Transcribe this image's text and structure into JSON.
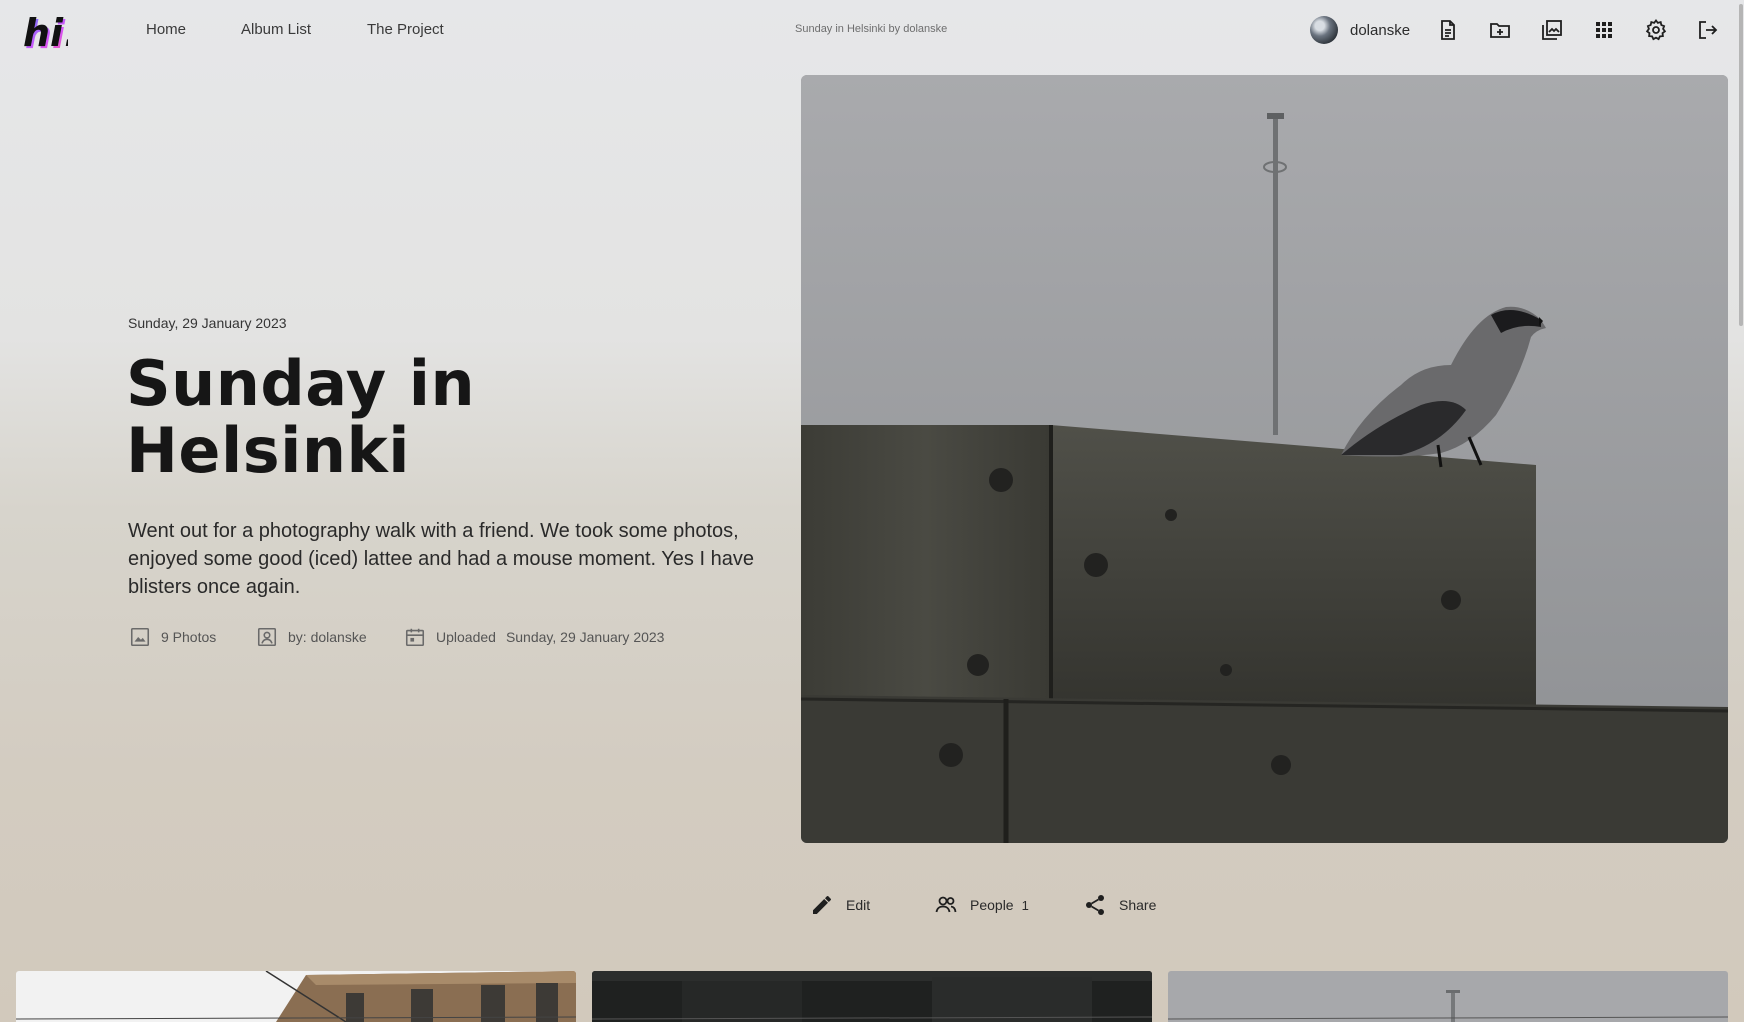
{
  "nav": {
    "logo_text": "hi!",
    "links": [
      {
        "label": "Home"
      },
      {
        "label": "Album List"
      },
      {
        "label": "The Project"
      }
    ],
    "page_caption": "Sunday in Helsinki by dolanske",
    "user": {
      "name": "dolanske",
      "avatar_icon": "avatar-photo"
    },
    "tool_icons": [
      "document-icon",
      "folder-add-icon",
      "gallery-icon",
      "grid-icon",
      "gear-icon",
      "logout-icon"
    ]
  },
  "album": {
    "date": "Sunday, 29 January 2023",
    "title": "Sunday in Helsinki",
    "description": "Went out for a photography walk with a friend. We took some photos, enjoyed some good (iced) lattee and had a mouse moment. Yes I have blisters once again.",
    "meta": {
      "photos": "9 Photos",
      "author": "by: dolanske",
      "uploaded_label": "Uploaded",
      "uploaded_date": "Sunday, 29 January 2023"
    }
  },
  "actions": {
    "edit": "Edit",
    "people": "People",
    "people_count": "1",
    "share": "Share"
  },
  "colors": {
    "text": "#1b1b1b",
    "muted": "#555555",
    "background_top": "#e6e7e9",
    "background_bottom": "#d2c9bc"
  }
}
